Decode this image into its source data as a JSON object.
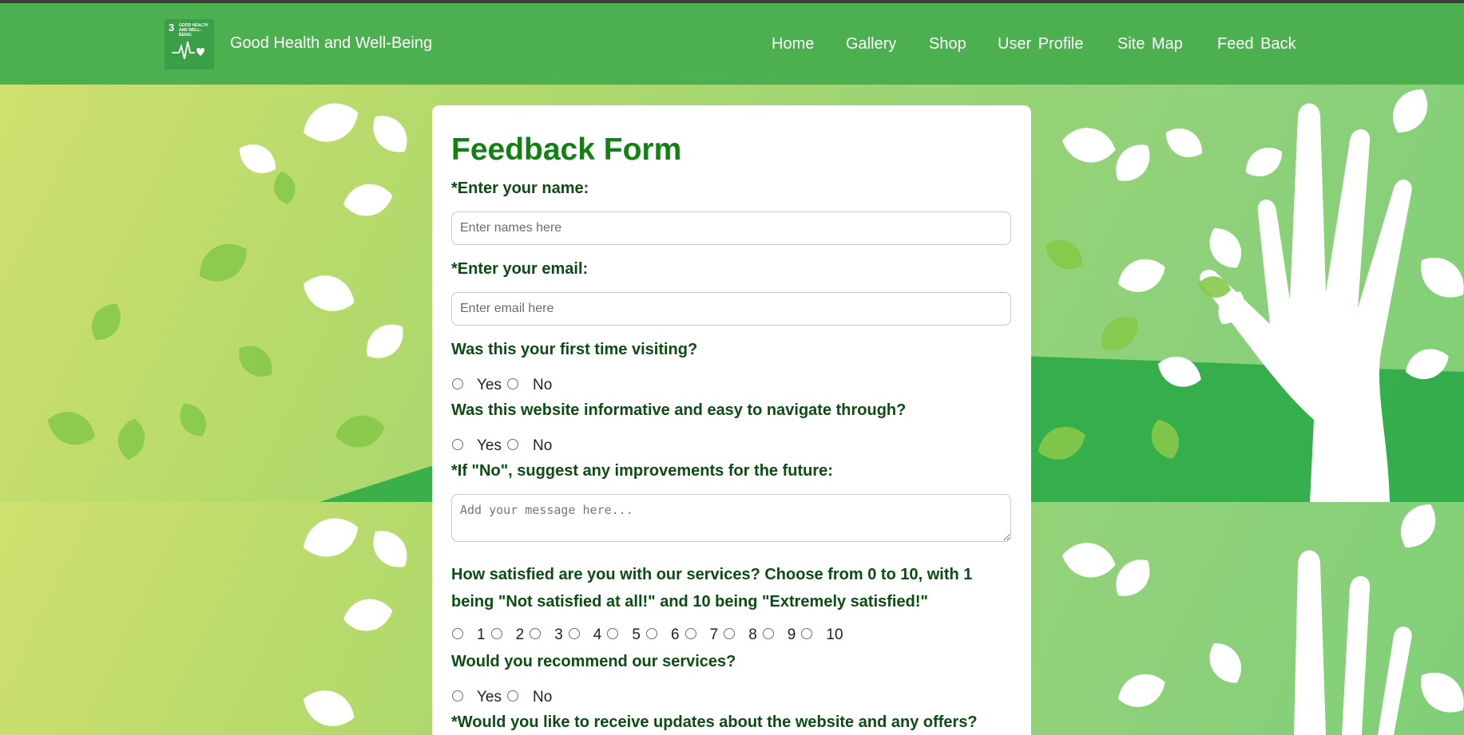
{
  "header": {
    "logo": {
      "number": "3",
      "text": "GOOD HEALTH AND WELL-BEING",
      "icon": "heartbeat-heart-icon"
    },
    "site_title": "Good Health and Well-Being",
    "nav": [
      {
        "label": "Home"
      },
      {
        "label": "Gallery"
      },
      {
        "label": "Shop"
      },
      {
        "label": "User Profile"
      },
      {
        "label": "Site Map"
      },
      {
        "label": "Feed Back"
      }
    ]
  },
  "colors": {
    "nav_bg": "#4caf50",
    "title_green": "#128012",
    "question_green": "#0b4d12",
    "background_gradient": [
      "#cfe06e",
      "#8fd17a"
    ]
  },
  "form": {
    "title": "Feedback Form",
    "name_label": "*Enter your name:",
    "name_placeholder": "Enter names here",
    "email_label": "*Enter your email:",
    "email_placeholder": "Enter email here",
    "first_visit_question": "Was this your first time visiting?",
    "informative_question": "Was this website informative and easy to navigate through?",
    "improvement_label": "*If \"No\", suggest any improvements for the future:",
    "message_placeholder": "Add your message here...",
    "satisfaction_question": "How satisfied are you with our services? Choose from 0 to 10, with 1 being \"Not satisfied at all!\" and 10 being \"Extremely satisfied!\"",
    "satisfaction_options": [
      "1",
      "2",
      "3",
      "4",
      "5",
      "6",
      "7",
      "8",
      "9",
      "10"
    ],
    "recommend_question": "Would you recommend our services?",
    "updates_question": "*Would you like to receive updates about the website and any offers?",
    "yes": "Yes",
    "no": "No"
  }
}
